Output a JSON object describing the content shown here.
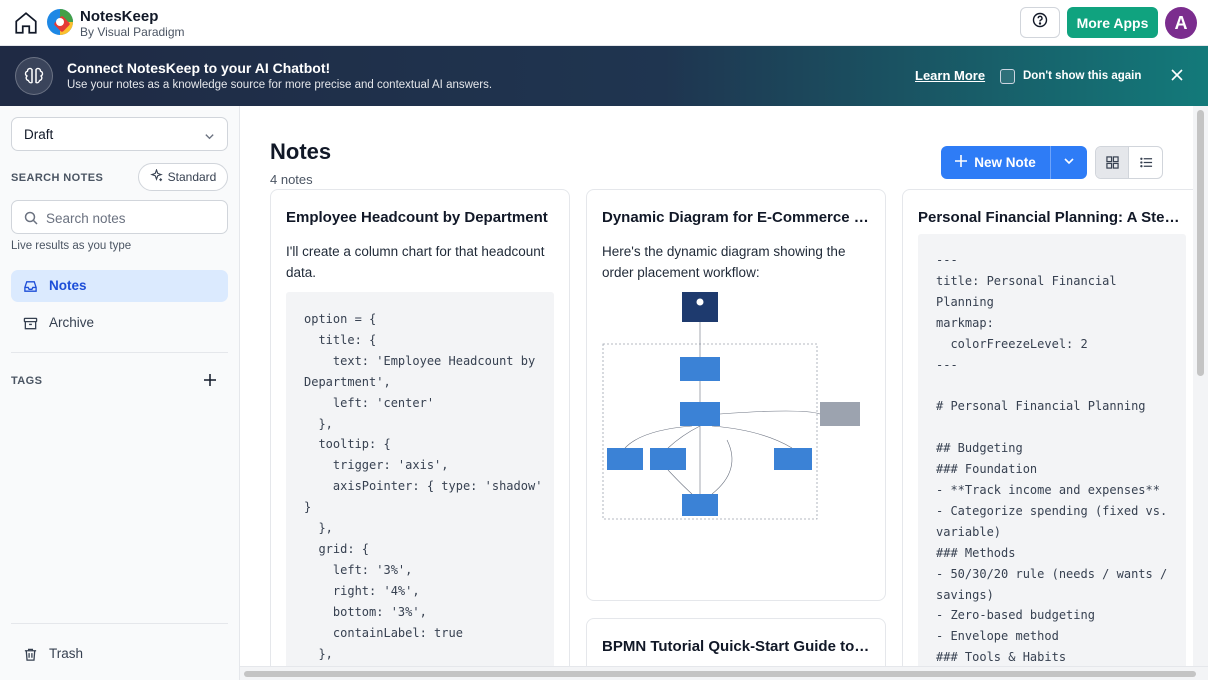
{
  "app": {
    "name": "NotesKeep",
    "subtitle": "By Visual Paradigm",
    "avatar_initial": "A",
    "more_apps_label": "More Apps"
  },
  "banner": {
    "title": "Connect NotesKeep to your AI Chatbot!",
    "subtitle": "Use your notes as a knowledge source for more precise and contextual AI answers.",
    "learn_more": "Learn More",
    "dont_show": "Don't show this again"
  },
  "sidebar": {
    "status_select": "Draft",
    "search_heading": "SEARCH NOTES",
    "search_mode": "Standard",
    "search_placeholder": "Search notes",
    "search_hint": "Live results as you type",
    "nav": [
      {
        "label": "Notes",
        "icon": "inbox-icon",
        "active": true
      },
      {
        "label": "Archive",
        "icon": "archive-icon",
        "active": false
      }
    ],
    "tags_heading": "TAGS",
    "trash": "Trash"
  },
  "main": {
    "title": "Notes",
    "count": "4 notes",
    "new_note": "New Note",
    "notes": [
      {
        "title": "Employee Headcount by Department",
        "intro": "I'll create a column chart for that headcount data.",
        "code": "option = {\n  title: {\n    text: 'Employee Headcount by\nDepartment',\n    left: 'center'\n  },\n  tooltip: {\n    trigger: 'axis',\n    axisPointer: { type: 'shadow'\n}\n  },\n  grid: {\n    left: '3%',\n    right: '4%',\n    bottom: '3%',\n    containLabel: true\n  },"
      },
      {
        "title": "Dynamic Diagram for E-Commerce Order Placement",
        "intro": "Here's the dynamic diagram showing the order placement workflow:"
      },
      {
        "title": "Personal Financial Planning: A Step-by-Step Guide",
        "code": "---\ntitle: Personal Financial\nPlanning\nmarkmap:\n  colorFreezeLevel: 2\n---\n\n# Personal Financial Planning\n\n## Budgeting\n### Foundation\n- **Track income and expenses**\n- Categorize spending (fixed vs.\nvariable)\n### Methods\n- 50/30/20 rule (needs / wants /\nsavings)\n- Zero-based budgeting\n- Envelope method\n### Tools & Habits"
      },
      {
        "title": "BPMN Tutorial Quick-Start Guide to Business Process Modeling"
      }
    ]
  },
  "colors": {
    "primary": "#2e7cf6",
    "more_apps": "#10a37f",
    "avatar": "#7b2d8e",
    "active_nav_bg": "#dbeafe"
  }
}
